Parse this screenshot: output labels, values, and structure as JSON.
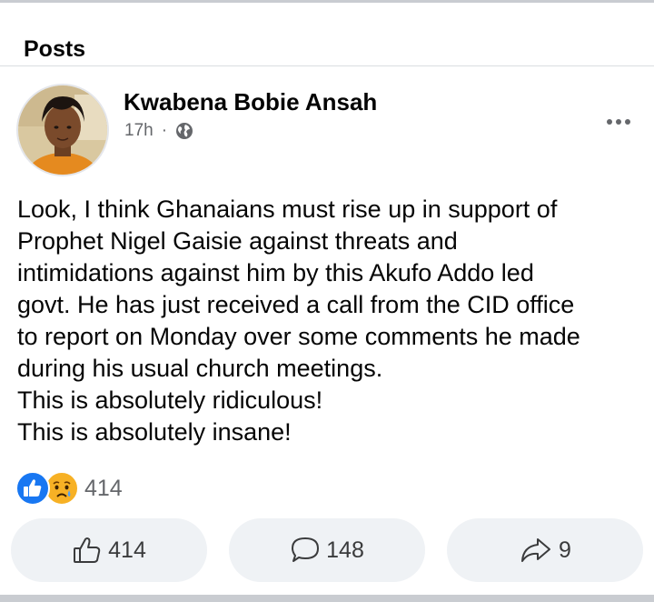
{
  "header": {
    "title": "Posts"
  },
  "post": {
    "author": "Kwabena Bobie Ansah",
    "time": "17h",
    "separator": "·",
    "privacy_icon": "globe-icon",
    "more_icon": "more-horizontal-icon",
    "lines": [
      "Look, I think Ghanaians must rise up in support of",
      "Prophet Nigel Gaisie against threats and",
      "intimidations against him by this Akufo Addo led",
      "govt. He has just received a call from the CID office",
      "to report on Monday over some comments he made",
      "during his usual church meetings.",
      "This is absolutely ridiculous!",
      "This is absolutely insane!"
    ]
  },
  "reactions": {
    "icons": [
      "like-reaction-icon",
      "sad-reaction-icon"
    ],
    "count": "414"
  },
  "actions": {
    "like_count": "414",
    "comment_count": "148",
    "share_count": "9"
  },
  "colors": {
    "like_blue": "#1877f2",
    "sad_yellow": "#f7b125",
    "button_bg": "#eff2f5",
    "meta_gray": "#65676b"
  }
}
